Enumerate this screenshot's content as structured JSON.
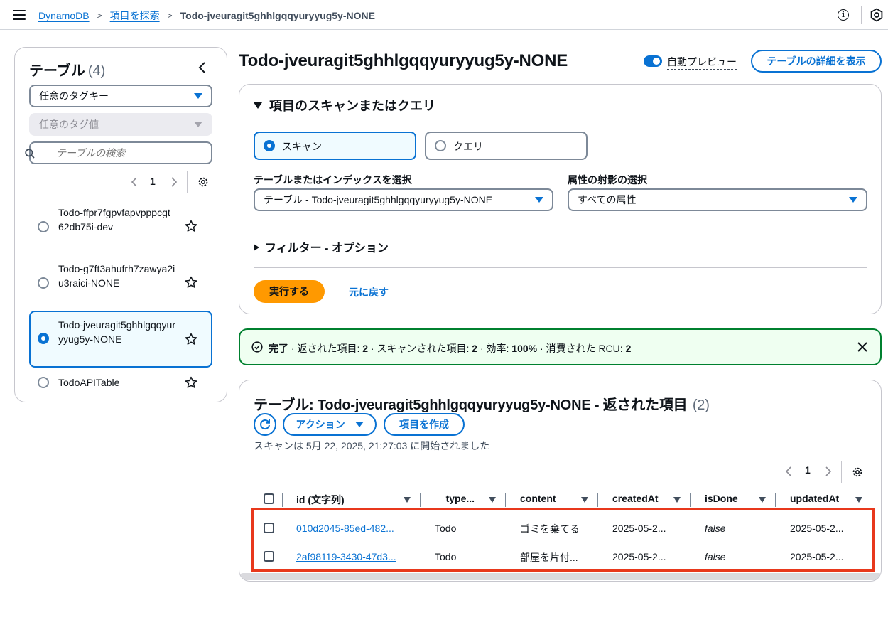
{
  "breadcrumb": {
    "items": [
      "DynamoDB",
      "項目を探索"
    ],
    "current": "Todo-jveuragit5ghhlgqqyuryyug5y-NONE"
  },
  "sidebar": {
    "title": "テーブル",
    "count": "(4)",
    "tag_key_select": "任意のタグキー",
    "tag_value_select": "任意のタグ値",
    "search_placeholder": "テーブルの検索",
    "page": "1",
    "tables": [
      {
        "name": "Todo-ffpr7fgpvfapvpppcgt62db75i-dev",
        "selected": false
      },
      {
        "name": "Todo-g7ft3ahufrh7zawya2iu3raici-NONE",
        "selected": false
      },
      {
        "name": "Todo-jveuragit5ghhlgqqyuryyug5y-NONE",
        "selected": true
      },
      {
        "name": "TodoAPITable",
        "selected": false
      }
    ]
  },
  "main": {
    "title": "Todo-jveuragit5ghhlgqqyuryyug5y-NONE",
    "auto_preview_label": "自動プレビュー",
    "table_details_button": "テーブルの詳細を表示"
  },
  "scan_panel": {
    "heading": "項目のスキャンまたはクエリ",
    "scan_label": "スキャン",
    "query_label": "クエリ",
    "table_select_label": "テーブルまたはインデックスを選択",
    "table_select_value": "テーブル - Todo-jveuragit5ghhlgqqyuryyug5y-NONE",
    "projection_label": "属性の射影の選択",
    "projection_value": "すべての属性",
    "filter_label": "フィルター - オプション",
    "run_button": "実行する",
    "reset_link": "元に戻す"
  },
  "flash": {
    "strong": "完了",
    "parts": [
      "· 返された項目: ",
      "2",
      " · スキャンされた項目: ",
      "2",
      " · 効率: ",
      "100%",
      " · 消費された RCU: ",
      "2"
    ]
  },
  "results": {
    "title": "テーブル: Todo-jveuragit5ghhlgqqyuryyug5y-NONE - 返された項目",
    "count": "(2)",
    "actions_button": "アクション",
    "create_item_button": "項目を作成",
    "scan_started": "スキャンは 5月 22, 2025, 21:27:03 に開始されました",
    "page": "1",
    "columns": [
      "id (文字列)",
      "__type...",
      "content",
      "createdAt",
      "isDone",
      "updatedAt"
    ],
    "rows": [
      [
        "010d2045-85ed-482...",
        "Todo",
        "ゴミを棄てる",
        "2025-05-2...",
        "false",
        "2025-05-2..."
      ],
      [
        "2af98119-3430-47d3...",
        "Todo",
        "部屋を片付...",
        "2025-05-2...",
        "false",
        "2025-05-2..."
      ]
    ]
  }
}
